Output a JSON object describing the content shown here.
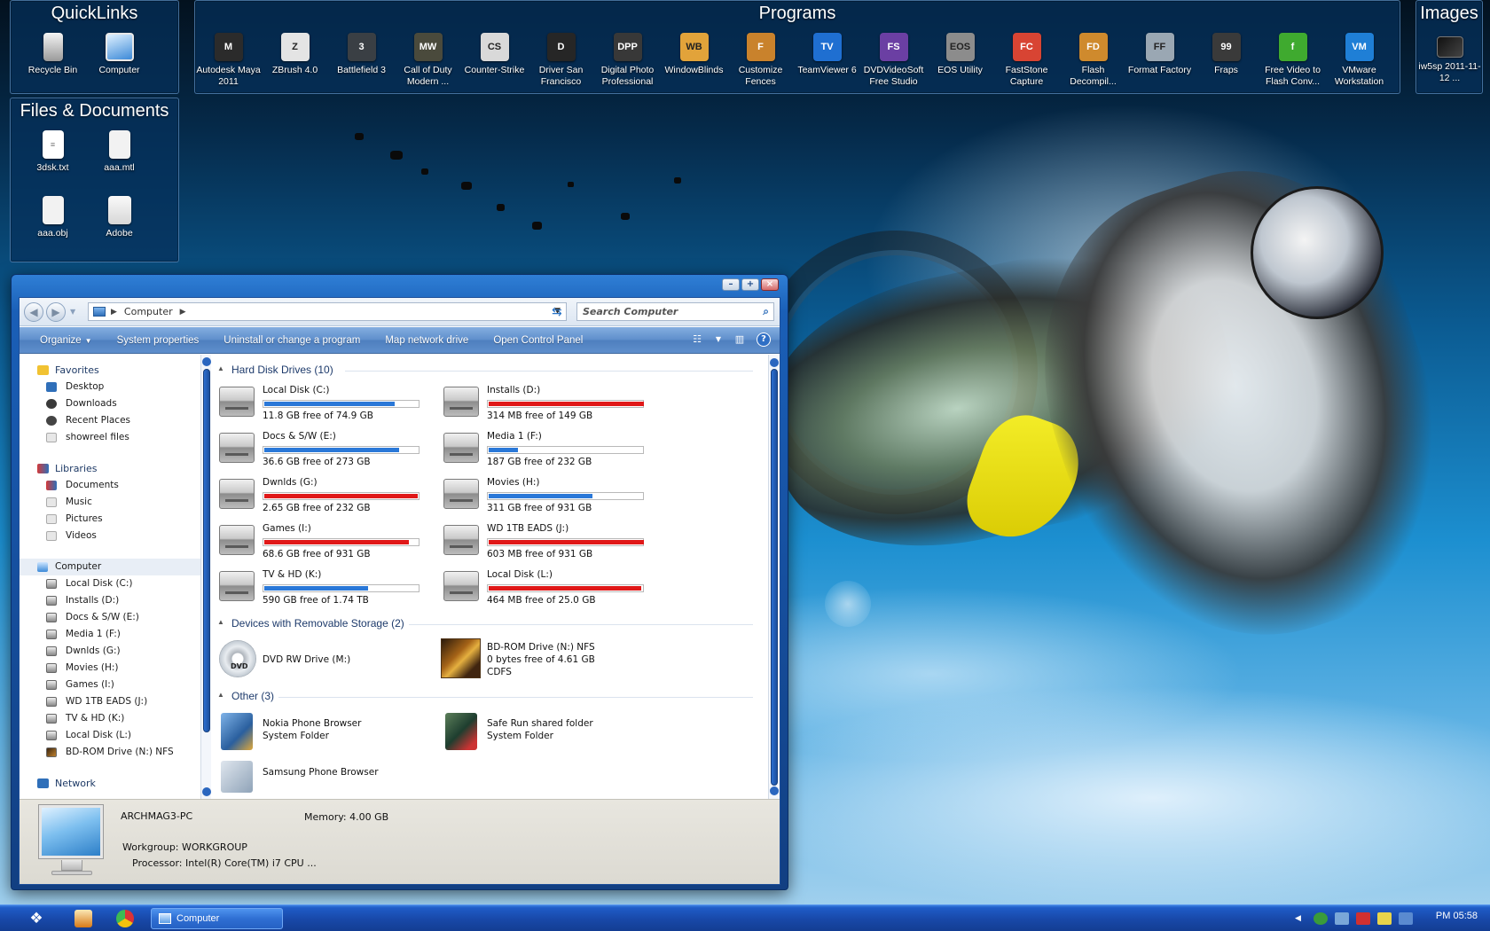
{
  "fences": {
    "quicklinks": {
      "title": "QuickLinks",
      "items": [
        {
          "label": "Recycle Bin",
          "icon": "recycle-bin-icon"
        },
        {
          "label": "Computer",
          "icon": "computer-icon"
        }
      ]
    },
    "programs": {
      "title": "Programs",
      "items": [
        {
          "label": "Autodesk Maya 2011",
          "icon": "maya-icon",
          "color": "#2b2b2b",
          "glyph": "M"
        },
        {
          "label": "ZBrush 4.0",
          "icon": "zbrush-icon",
          "color": "#e4e4e4",
          "glyph": "Z"
        },
        {
          "label": "Battlefield 3",
          "icon": "battlefield-icon",
          "color": "#3a3f44",
          "glyph": "3"
        },
        {
          "label": "Call of Duty Modern ...",
          "icon": "call-of-duty-icon",
          "color": "#4a4a3c",
          "glyph": "MW"
        },
        {
          "label": "Counter-Strike",
          "icon": "counter-strike-icon",
          "color": "#d9d9d9",
          "glyph": "CS"
        },
        {
          "label": "Driver San Francisco",
          "icon": "driver-icon",
          "color": "#262626",
          "glyph": "D"
        },
        {
          "label": "Digital Photo Professional",
          "icon": "digital-photo-icon",
          "color": "#383838",
          "glyph": "DPP"
        },
        {
          "label": "WindowBlinds",
          "icon": "windowblinds-icon",
          "color": "#e2a33a",
          "glyph": "WB"
        },
        {
          "label": "Customize Fences",
          "icon": "fences-icon",
          "color": "#c9822c",
          "glyph": "F"
        },
        {
          "label": "TeamViewer 6",
          "icon": "teamviewer-icon",
          "color": "#1f6fd1",
          "glyph": "TV"
        },
        {
          "label": "DVDVideoSoft Free Studio",
          "icon": "dvdvideosoft-icon",
          "color": "#6b3fa3",
          "glyph": "FS"
        },
        {
          "label": "EOS Utility",
          "icon": "eos-utility-icon",
          "color": "#8c8c8c",
          "glyph": "EOS"
        },
        {
          "label": "FastStone Capture",
          "icon": "faststone-icon",
          "color": "#d84433",
          "glyph": "FC"
        },
        {
          "label": "Flash Decompil...",
          "icon": "flash-decompiler-icon",
          "color": "#cf8a2d",
          "glyph": "FD"
        },
        {
          "label": "Format Factory",
          "icon": "format-factory-icon",
          "color": "#9aa7b3",
          "glyph": "FF"
        },
        {
          "label": "Fraps",
          "icon": "fraps-icon",
          "color": "#3a3a3a",
          "glyph": "99"
        },
        {
          "label": "Free Video to Flash Conv...",
          "icon": "flash-converter-icon",
          "color": "#3faa2f",
          "glyph": "f"
        },
        {
          "label": "VMware Workstation",
          "icon": "vmware-icon",
          "color": "#1f7fd6",
          "glyph": "VM"
        }
      ]
    },
    "images": {
      "title": "Images",
      "items": [
        {
          "label": "iw5sp 2011-11-12 ...",
          "icon": "image-thumbnail-icon"
        }
      ]
    },
    "files": {
      "title": "Files & Documents",
      "items": [
        {
          "label": "3dsk.txt",
          "icon": "text-file-icon"
        },
        {
          "label": "aaa.mtl",
          "icon": "file-icon"
        },
        {
          "label": "aaa.obj",
          "icon": "file-icon"
        },
        {
          "label": "Adobe",
          "icon": "folder-icon"
        }
      ]
    }
  },
  "explorer": {
    "breadcrumb": "Computer",
    "search_placeholder": "Search Computer",
    "commands": [
      "Organize",
      "System properties",
      "Uninstall or change a program",
      "Map network drive",
      "Open Control Panel"
    ],
    "nav": {
      "favorites": {
        "label": "Favorites",
        "items": [
          "Desktop",
          "Downloads",
          "Recent Places",
          "showreel files"
        ]
      },
      "libraries": {
        "label": "Libraries",
        "items": [
          "Documents",
          "Music",
          "Pictures",
          "Videos"
        ]
      },
      "computer": {
        "label": "Computer",
        "items": [
          "Local Disk (C:)",
          "Installs (D:)",
          "Docs & S/W (E:)",
          "Media 1 (F:)",
          "Dwnlds (G:)",
          "Movies (H:)",
          "Games (I:)",
          "WD 1TB EADS (J:)",
          "TV & HD (K:)",
          "Local Disk (L:)",
          "BD-ROM Drive (N:) NFS"
        ]
      },
      "network": {
        "label": "Network"
      }
    },
    "groups": {
      "hard_disks": "Hard Disk Drives (10)",
      "removable": "Devices with Removable Storage (2)",
      "other": "Other (3)"
    },
    "drives": [
      {
        "name": "Local Disk (C:)",
        "free": "11.8 GB free of 74.9 GB",
        "used_fraction": 0.84,
        "status": "ok"
      },
      {
        "name": "Installs (D:)",
        "free": "314 MB free of 149 GB",
        "used_fraction": 0.998,
        "status": "full"
      },
      {
        "name": "Docs & S/W (E:)",
        "free": "36.6 GB free of 273 GB",
        "used_fraction": 0.87,
        "status": "ok"
      },
      {
        "name": "Media 1 (F:)",
        "free": "187 GB free of 232 GB",
        "used_fraction": 0.19,
        "status": "ok"
      },
      {
        "name": "Dwnlds (G:)",
        "free": "2.65 GB free of 232 GB",
        "used_fraction": 0.99,
        "status": "full"
      },
      {
        "name": "Movies (H:)",
        "free": "311 GB free of 931 GB",
        "used_fraction": 0.67,
        "status": "ok"
      },
      {
        "name": "Games (I:)",
        "free": "68.6 GB free of 931 GB",
        "used_fraction": 0.93,
        "status": "full"
      },
      {
        "name": "WD 1TB EADS (J:)",
        "free": "603 MB free of 931 GB",
        "used_fraction": 0.999,
        "status": "full"
      },
      {
        "name": "TV & HD (K:)",
        "free": "590 GB free of 1.74 TB",
        "used_fraction": 0.67,
        "status": "ok"
      },
      {
        "name": "Local Disk (L:)",
        "free": "464 MB free of 25.0 GB",
        "used_fraction": 0.98,
        "status": "full"
      }
    ],
    "bar_colors": {
      "ok": "#2a78d8",
      "full": "#e01818"
    },
    "removable": [
      {
        "name": "DVD RW Drive (M:)",
        "icon": "dvd-drive-icon"
      },
      {
        "name": "BD-ROM Drive (N:) NFS",
        "line2": "0 bytes free of 4.61 GB",
        "line3": "CDFS",
        "icon": "bd-rom-icon"
      }
    ],
    "other": [
      {
        "name": "Nokia Phone Browser",
        "line2": "System Folder",
        "icon": "nokia-phone-browser-icon"
      },
      {
        "name": "Safe Run shared folder",
        "line2": "System Folder",
        "icon": "safe-run-folder-icon"
      },
      {
        "name": "Samsung Phone Browser",
        "icon": "samsung-phone-browser-icon"
      }
    ],
    "details": {
      "computer_name": "ARCHMAG3-PC",
      "memory": "Memory: 4.00 GB",
      "workgroup": "Workgroup: WORKGROUP",
      "processor": "Processor: Intel(R) Core(TM) i7 CPU  ..."
    }
  },
  "taskbar": {
    "task_label": "Computer",
    "clock": "PM 05:58"
  }
}
